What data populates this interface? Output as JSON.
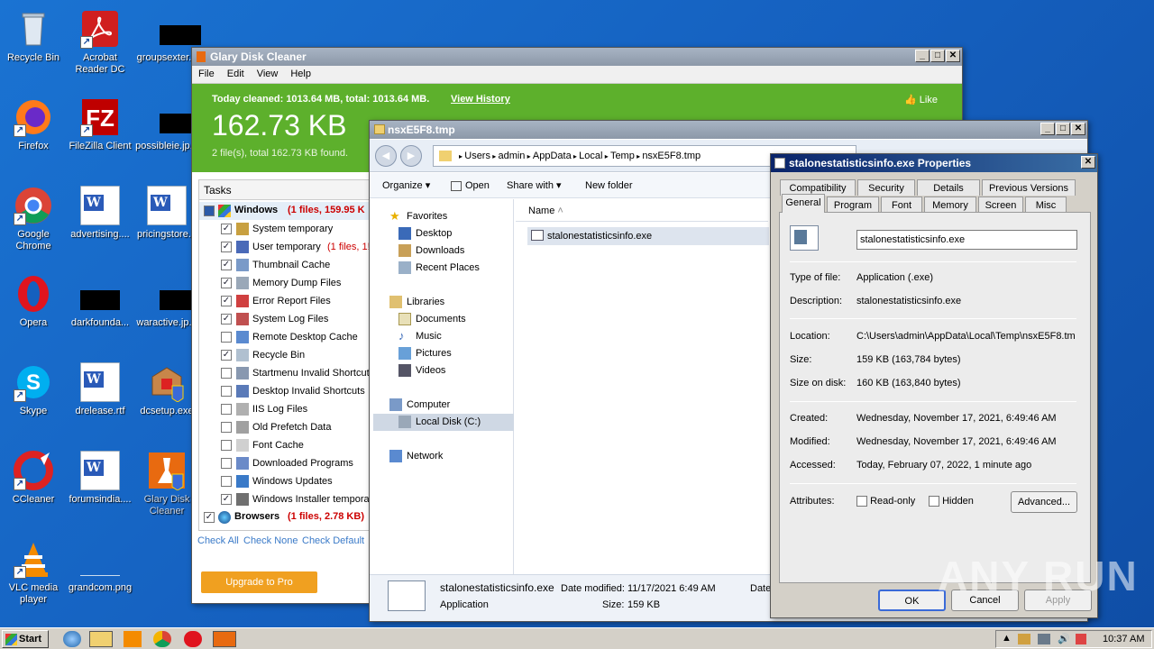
{
  "desktop_icons": [
    {
      "label": "Recycle Bin",
      "icon": "recycle-bin-icon"
    },
    {
      "label": "Acrobat Reader DC",
      "icon": "acrobat-icon"
    },
    {
      "label": "groupsexter...",
      "icon": "redacted-icon"
    },
    {
      "label": "Firefox",
      "icon": "firefox-icon"
    },
    {
      "label": "FileZilla Client",
      "icon": "filezilla-icon"
    },
    {
      "label": "possibleie.jp...",
      "icon": "redacted-icon"
    },
    {
      "label": "Google Chrome",
      "icon": "chrome-icon"
    },
    {
      "label": "advertising....",
      "icon": "word-doc-icon"
    },
    {
      "label": "pricingstore...",
      "icon": "word-doc-icon"
    },
    {
      "label": "Opera",
      "icon": "opera-icon"
    },
    {
      "label": "darkfounda...",
      "icon": "redacted-icon"
    },
    {
      "label": "waractive.jp...",
      "icon": "redacted-icon"
    },
    {
      "label": "Skype",
      "icon": "skype-icon"
    },
    {
      "label": "drelease.rtf",
      "icon": "word-doc-icon"
    },
    {
      "label": "dcsetup.exe",
      "icon": "installer-icon"
    },
    {
      "label": "CCleaner",
      "icon": "ccleaner-icon"
    },
    {
      "label": "forumsindia....",
      "icon": "word-doc-icon"
    },
    {
      "label": "Glary Disk Cleaner",
      "icon": "glary-icon"
    },
    {
      "label": "VLC media player",
      "icon": "vlc-icon"
    },
    {
      "label": "grandcom.png",
      "icon": "image-file-icon"
    }
  ],
  "glary": {
    "title": "Glary Disk Cleaner",
    "menu": [
      "File",
      "Edit",
      "View",
      "Help"
    ],
    "today": "Today cleaned: 1013.64 MB, total: 1013.64 MB.",
    "view_history": "View History",
    "like": "Like",
    "size": "162.73 KB",
    "found": "2 file(s), total 162.73 KB found.",
    "tasks_header": "Tasks",
    "windows_group": {
      "name": "Windows",
      "count": "(1 files,",
      "size": "159.95 K"
    },
    "tasks": [
      {
        "label": "System temporary",
        "checked": true
      },
      {
        "label": "User temporary",
        "extra": "(1 files, 1!",
        "checked": true
      },
      {
        "label": "Thumbnail Cache",
        "checked": true
      },
      {
        "label": "Memory Dump Files",
        "checked": true
      },
      {
        "label": "Error Report Files",
        "checked": true
      },
      {
        "label": "System Log Files",
        "checked": true
      },
      {
        "label": "Remote Desktop Cache",
        "checked": false
      },
      {
        "label": "Recycle Bin",
        "checked": true
      },
      {
        "label": "Startmenu Invalid Shortcut",
        "checked": false
      },
      {
        "label": "Desktop Invalid Shortcuts",
        "checked": false
      },
      {
        "label": "IIS Log Files",
        "checked": false
      },
      {
        "label": "Old Prefetch Data",
        "checked": false
      },
      {
        "label": "Font Cache",
        "checked": false
      },
      {
        "label": "Downloaded Programs",
        "checked": false
      },
      {
        "label": "Windows Updates",
        "checked": false
      },
      {
        "label": "Windows Installer tempora",
        "checked": true
      }
    ],
    "browsers_group": {
      "name": "Browsers",
      "count": "(1 files,",
      "size": "2.78 KB)"
    },
    "check_all": "Check All",
    "check_none": "Check None",
    "check_default": "Check Default",
    "upgrade": "Upgrade to Pro"
  },
  "explorer": {
    "title": "nsxE5F8.tmp",
    "breadcrumb": [
      "Users",
      "admin",
      "AppData",
      "Local",
      "Temp",
      "nsxE5F8.tmp"
    ],
    "toolbar": {
      "organize": "Organize",
      "open": "Open",
      "share": "Share with",
      "new_folder": "New folder"
    },
    "nav": {
      "favorites": "Favorites",
      "desktop": "Desktop",
      "downloads": "Downloads",
      "recent": "Recent Places",
      "libraries": "Libraries",
      "documents": "Documents",
      "music": "Music",
      "pictures": "Pictures",
      "videos": "Videos",
      "computer": "Computer",
      "local_disk": "Local Disk (C:)",
      "network": "Network"
    },
    "col_name": "Name",
    "file": "stalonestatisticsinfo.exe",
    "details": {
      "name": "stalonestatisticsinfo.exe",
      "type": "Application",
      "modified_label": "Date modified:",
      "modified": "11/17/2021 6:49 AM",
      "size_label": "Size:",
      "size": "159 KB",
      "date": "Date"
    }
  },
  "props": {
    "title": "stalonestatisticsinfo.exe Properties",
    "tabs_top": [
      "Compatibility",
      "Security",
      "Details",
      "Previous Versions"
    ],
    "tabs_bottom": [
      "General",
      "Program",
      "Font",
      "Memory",
      "Screen",
      "Misc"
    ],
    "filename": "stalonestatisticsinfo.exe",
    "type_k": "Type of file:",
    "type_v": "Application (.exe)",
    "desc_k": "Description:",
    "desc_v": "stalonestatisticsinfo.exe",
    "loc_k": "Location:",
    "loc_v": "C:\\Users\\admin\\AppData\\Local\\Temp\\nsxE5F8.tm",
    "size_k": "Size:",
    "size_v": "159 KB (163,784 bytes)",
    "disk_k": "Size on disk:",
    "disk_v": "160 KB (163,840 bytes)",
    "created_k": "Created:",
    "created_v": "Wednesday, November 17, 2021, 6:49:46 AM",
    "modified_k": "Modified:",
    "modified_v": "Wednesday, November 17, 2021, 6:49:46 AM",
    "accessed_k": "Accessed:",
    "accessed_v": "Today, February 07, 2022, 1 minute ago",
    "attr_k": "Attributes:",
    "readonly": "Read-only",
    "hidden": "Hidden",
    "advanced": "Advanced...",
    "ok": "OK",
    "cancel": "Cancel",
    "apply": "Apply"
  },
  "taskbar": {
    "start": "Start",
    "clock": "10:37 AM"
  },
  "watermark": "ANY RUN"
}
